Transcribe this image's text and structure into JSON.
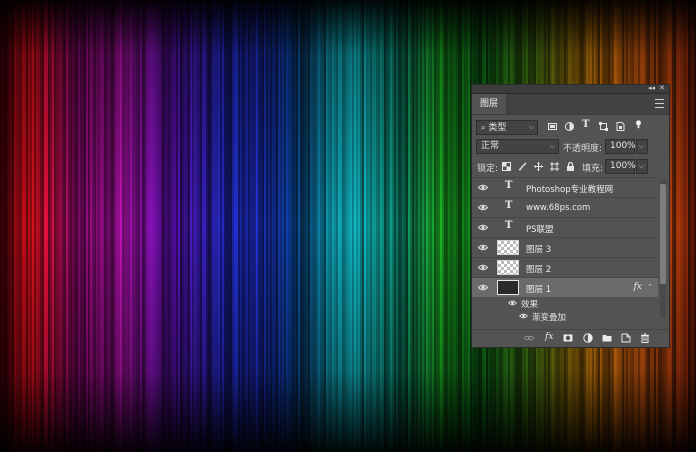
{
  "canvas": {
    "description_colors": [
      "#e8101d",
      "#a1109c",
      "#2030d0",
      "#0ea0a8",
      "#19a020",
      "#e06010"
    ]
  },
  "panel": {
    "tab_label": "图层",
    "filter": {
      "label": "类型",
      "icons": [
        "image-filter-icon",
        "adjustment-filter-icon",
        "type-filter-icon",
        "shape-filter-icon",
        "smart-object-filter-icon",
        "filter-toggle-icon"
      ]
    },
    "blend_mode": "正常",
    "opacity_label": "不透明度:",
    "opacity_value": "100%",
    "lock_label": "锁定:",
    "fill_label": "填充:",
    "fill_value": "100%",
    "layers": [
      {
        "type": "text",
        "icon": "T",
        "name": "Photoshop专业教程网"
      },
      {
        "type": "text",
        "icon": "T",
        "name": "www.68ps.com"
      },
      {
        "type": "text",
        "icon": "T",
        "name": "PS联盟"
      },
      {
        "type": "pixel",
        "name": "图层 3"
      },
      {
        "type": "pixel",
        "name": "图层 2"
      },
      {
        "type": "pixel",
        "name": "图层 1",
        "selected": true,
        "fx": "fx"
      }
    ],
    "effects_label": "效果",
    "effect_item": "渐变叠加",
    "bottom_fx": "fx"
  }
}
